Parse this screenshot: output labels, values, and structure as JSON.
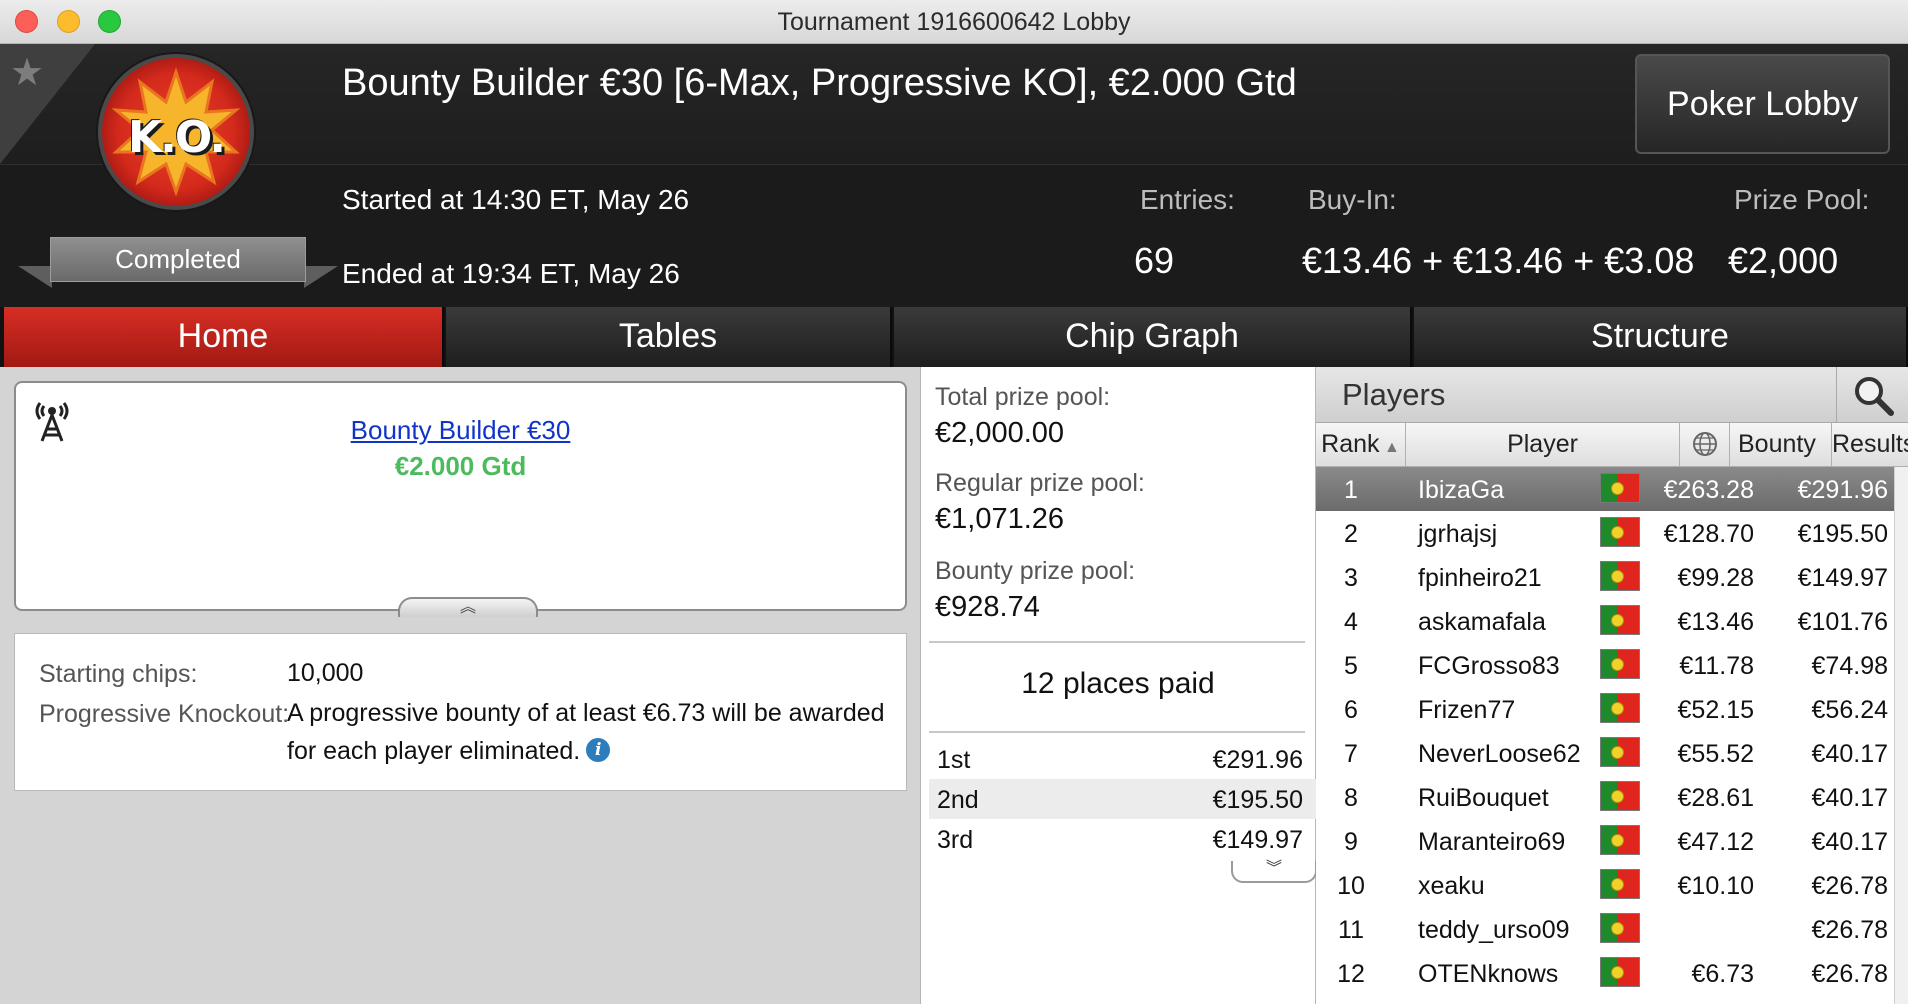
{
  "window": {
    "title": "Tournament 1916600642 Lobby"
  },
  "header": {
    "logo_text": "K.O.",
    "status": "Completed",
    "title": "Bounty Builder €30 [6-Max, Progressive KO], €2.000 Gtd",
    "started": "Started at 14:30 ET, May 26",
    "ended": "Ended at 19:34 ET, May 26",
    "entries_label": "Entries:",
    "entries_value": "69",
    "buyin_label": "Buy-In:",
    "buyin_value": "€13.46 + €13.46 + €3.08",
    "prizepool_label": "Prize Pool:",
    "prizepool_value": "€2,000",
    "poker_lobby_label": "Poker Lobby"
  },
  "tabs": [
    {
      "label": "Home",
      "active": true
    },
    {
      "label": "Tables",
      "active": false
    },
    {
      "label": "Chip Graph",
      "active": false
    },
    {
      "label": "Structure",
      "active": false
    }
  ],
  "info_card": {
    "link": "Bounty Builder €30",
    "gtd": "€2.000 Gtd"
  },
  "details": {
    "starting_chips_label": "Starting chips:",
    "starting_chips_value": "10,000",
    "pko_label": "Progressive Knockout:",
    "pko_value": "A progressive bounty of at least €6.73 will be awarded for each player eliminated."
  },
  "prizes": {
    "total_label": "Total prize pool:",
    "total_value": "€2,000.00",
    "regular_label": "Regular prize pool:",
    "regular_value": "€1,071.26",
    "bounty_label": "Bounty prize pool:",
    "bounty_value": "€928.74",
    "places_paid": "12 places paid",
    "payouts": [
      {
        "place": "1st",
        "amount": "€291.96"
      },
      {
        "place": "2nd",
        "amount": "€195.50"
      },
      {
        "place": "3rd",
        "amount": "€149.97"
      }
    ]
  },
  "players": {
    "title": "Players",
    "columns": {
      "rank": "Rank",
      "player": "Player",
      "bounty": "Bounty",
      "results": "Results"
    },
    "flag_colors": {
      "green": "#1f8a2c",
      "red": "#e0251f"
    },
    "rows": [
      {
        "rank": "1",
        "name": "IbizaGa",
        "bounty": "€263.28",
        "result": "€291.96",
        "selected": true
      },
      {
        "rank": "2",
        "name": "jgrhajsj",
        "bounty": "€128.70",
        "result": "€195.50"
      },
      {
        "rank": "3",
        "name": "fpinheiro21",
        "bounty": "€99.28",
        "result": "€149.97"
      },
      {
        "rank": "4",
        "name": "askamafala",
        "bounty": "€13.46",
        "result": "€101.76"
      },
      {
        "rank": "5",
        "name": "FCGrosso83",
        "bounty": "€11.78",
        "result": "€74.98"
      },
      {
        "rank": "6",
        "name": "Frizen77",
        "bounty": "€52.15",
        "result": "€56.24"
      },
      {
        "rank": "7",
        "name": "NeverLoose62",
        "bounty": "€55.52",
        "result": "€40.17"
      },
      {
        "rank": "8",
        "name": "RuiBouquet",
        "bounty": "€28.61",
        "result": "€40.17"
      },
      {
        "rank": "9",
        "name": "Maranteiro69",
        "bounty": "€47.12",
        "result": "€40.17"
      },
      {
        "rank": "10",
        "name": "xeaku",
        "bounty": "€10.10",
        "result": "€26.78"
      },
      {
        "rank": "11",
        "name": "teddy_urso09",
        "bounty": "",
        "result": "€26.78"
      },
      {
        "rank": "12",
        "name": "OTENknows",
        "bounty": "€6.73",
        "result": "€26.78"
      }
    ]
  }
}
